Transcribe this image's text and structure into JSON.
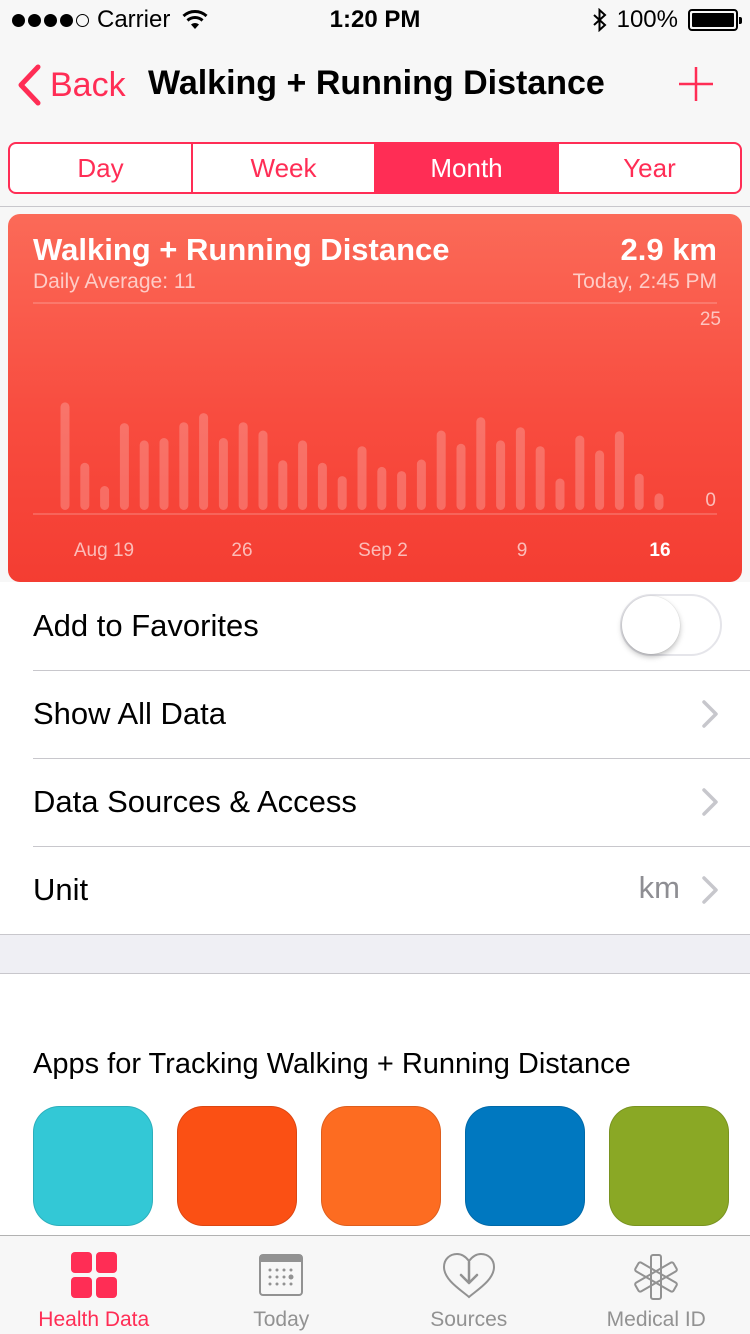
{
  "status_bar": {
    "carrier": "Carrier",
    "time": "1:20 PM",
    "battery": "100%"
  },
  "nav": {
    "back_label": "Back",
    "title": "Walking + Running Distance"
  },
  "segments": [
    {
      "label": "Day",
      "active": false
    },
    {
      "label": "Week",
      "active": false
    },
    {
      "label": "Month",
      "active": true
    },
    {
      "label": "Year",
      "active": false
    }
  ],
  "card": {
    "title": "Walking + Running Distance",
    "subtitle": "Daily Average: 11",
    "value": "2.9 km",
    "timestamp": "Today, 2:45 PM"
  },
  "chart_data": {
    "type": "bar",
    "values": [
      13,
      5.7,
      2.9,
      10.5,
      8.4,
      8.7,
      10.6,
      11.7,
      8.7,
      10.6,
      9.6,
      6,
      8.4,
      5.7,
      4.1,
      7.7,
      5.2,
      4.7,
      6.1,
      9.6,
      8,
      11.2,
      8.4,
      10,
      7.7,
      3.8,
      9,
      7.2,
      9.5,
      4.4,
      2
    ],
    "x_tick_labels": [
      {
        "label": "Aug 19",
        "bold": false
      },
      {
        "label": "26",
        "bold": false
      },
      {
        "label": "Sep 2",
        "bold": false
      },
      {
        "label": "9",
        "bold": false
      },
      {
        "label": "16",
        "bold": true
      }
    ],
    "ylim": [
      0,
      25
    ],
    "y_tick_labels": [
      "25",
      "0"
    ]
  },
  "rows": {
    "favorites": "Add to Favorites",
    "favorites_on": false,
    "show_all": "Show All Data",
    "sources": "Data Sources & Access",
    "unit": "Unit",
    "unit_value": "km"
  },
  "apps": {
    "title": "Apps for Tracking Walking + Running Distance",
    "icon_colors": [
      "#33c8d6",
      "#fb5014",
      "#fd6c21",
      "#0078c0",
      "#8aa825"
    ]
  },
  "tabs": [
    {
      "label": "Health Data",
      "icon": "health-data-icon",
      "active": true
    },
    {
      "label": "Today",
      "icon": "calendar-icon",
      "active": false
    },
    {
      "label": "Sources",
      "icon": "sources-heart-icon",
      "active": false
    },
    {
      "label": "Medical ID",
      "icon": "medical-id-icon",
      "active": false
    }
  ],
  "colors": {
    "accent": "#ff2d55",
    "card": "#f84c3f"
  }
}
